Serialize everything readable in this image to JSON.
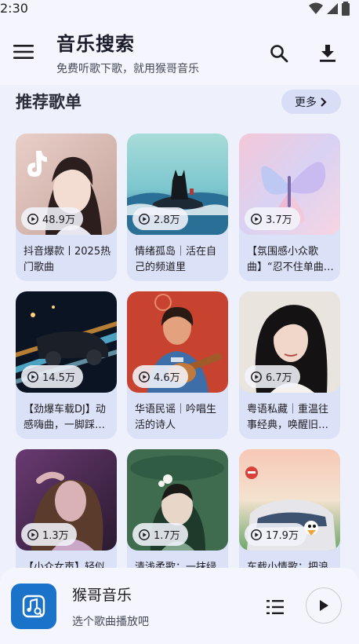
{
  "status_bar": {
    "time": "2:30"
  },
  "header": {
    "title": "音乐搜索",
    "subtitle": "免费听歌下歌，就用猴哥音乐"
  },
  "section": {
    "title": "推荐歌单",
    "more_label": "更多"
  },
  "playlists": [
    {
      "plays": "48.9万",
      "title": "抖音爆款丨2025热门歌曲"
    },
    {
      "plays": "2.8万",
      "title": "情绪孤岛｜活在自己的频道里"
    },
    {
      "plays": "3.7万",
      "title": "【氛围感小众歌曲】“忍不住单曲…"
    },
    {
      "plays": "14.5万",
      "title": "【劲爆车载DJ】动感嗨曲，一脚踩…"
    },
    {
      "plays": "4.6万",
      "title": "华语民谣｜吟唱生活的诗人"
    },
    {
      "plays": "6.7万",
      "title": "粤语私藏｜重温往事经典，唤醒旧…"
    },
    {
      "plays": "1.3万",
      "title": "【小众女声】轻似"
    },
    {
      "plays": "1.7万",
      "title": "清浅柔歌：一抹绿"
    },
    {
      "plays": "17.9万",
      "title": "车载小情歌：把浪"
    }
  ],
  "player": {
    "title": "猴哥音乐",
    "subtitle": "选个歌曲播放吧"
  },
  "colors": {
    "background": "#eef0fb",
    "card": "#dbe1f7",
    "accent": "#1a73c8"
  }
}
